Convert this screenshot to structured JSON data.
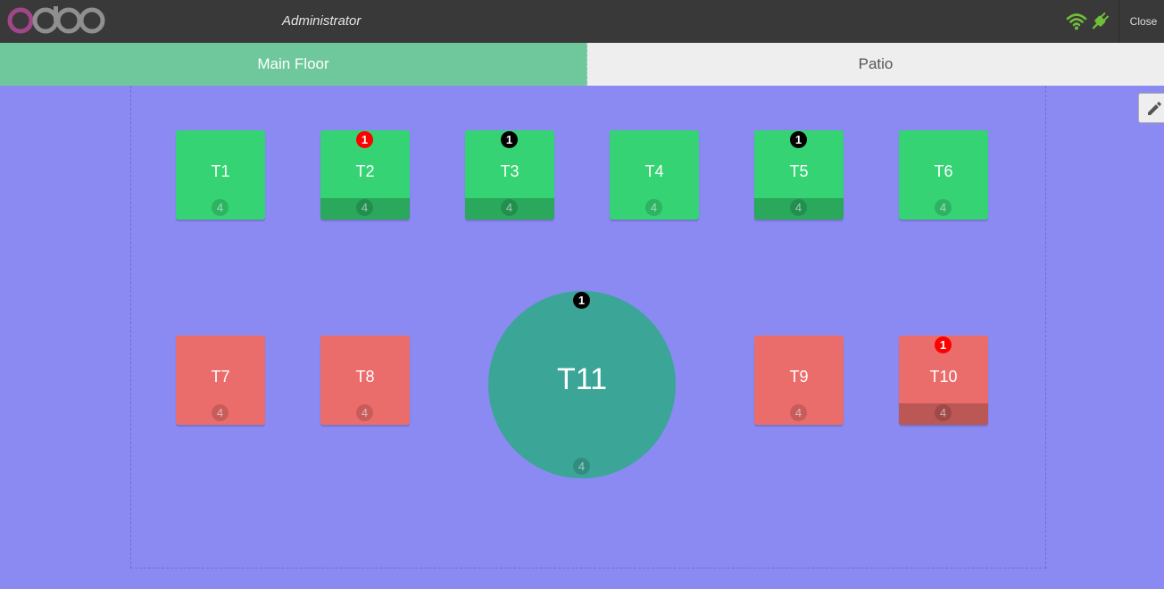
{
  "header": {
    "user": "Administrator",
    "close_label": "Close",
    "logo_text": "odoo",
    "status_color": "#6fbf3a"
  },
  "tabs": [
    {
      "label": "Main Floor",
      "active": true
    },
    {
      "label": "Patio",
      "active": false
    }
  ],
  "floor": {
    "background": "#8a8af2",
    "tables": [
      {
        "name": "T1",
        "seats": "4",
        "color": "green",
        "order_count": null,
        "badge": null,
        "occupied": false
      },
      {
        "name": "T2",
        "seats": "4",
        "color": "green",
        "order_count": "1",
        "badge": "red",
        "occupied": true
      },
      {
        "name": "T3",
        "seats": "4",
        "color": "green",
        "order_count": "1",
        "badge": "black",
        "occupied": true
      },
      {
        "name": "T4",
        "seats": "4",
        "color": "green",
        "order_count": null,
        "badge": null,
        "occupied": false
      },
      {
        "name": "T5",
        "seats": "4",
        "color": "green",
        "order_count": "1",
        "badge": "black",
        "occupied": true
      },
      {
        "name": "T6",
        "seats": "4",
        "color": "green",
        "order_count": null,
        "badge": null,
        "occupied": false
      },
      {
        "name": "T7",
        "seats": "4",
        "color": "red",
        "order_count": null,
        "badge": null,
        "occupied": false
      },
      {
        "name": "T8",
        "seats": "4",
        "color": "red",
        "order_count": null,
        "badge": null,
        "occupied": false
      },
      {
        "name": "T11",
        "seats": "4",
        "color": "teal",
        "order_count": "1",
        "badge": "black",
        "occupied": false
      },
      {
        "name": "T9",
        "seats": "4",
        "color": "red",
        "order_count": null,
        "badge": null,
        "occupied": false
      },
      {
        "name": "T10",
        "seats": "4",
        "color": "red",
        "order_count": "1",
        "badge": "red",
        "occupied": true
      }
    ]
  },
  "icons": [
    "wifi-icon",
    "plug-icon",
    "pencil-icon"
  ]
}
